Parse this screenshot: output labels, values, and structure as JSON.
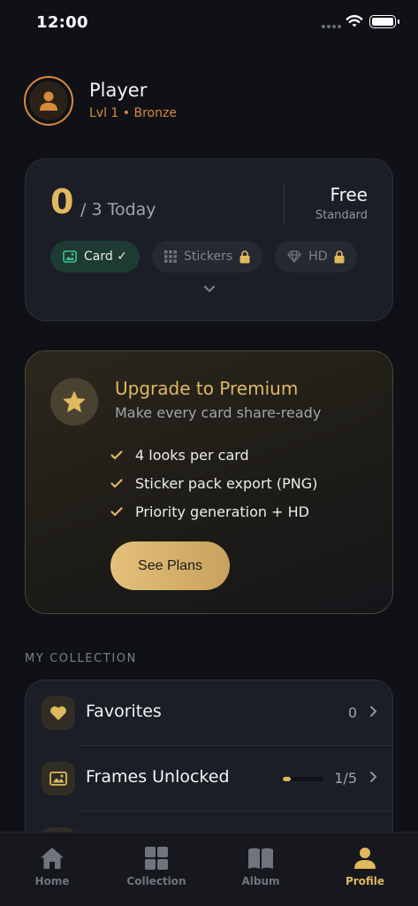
{
  "status": {
    "time": "12:00"
  },
  "profile": {
    "name": "Player",
    "level": "Lvl 1 • Bronze"
  },
  "usage": {
    "count": "0",
    "count_suffix": "/ 3 Today",
    "plan": "Free",
    "plan_tier": "Standard",
    "chips": [
      {
        "label": "Card ✓",
        "icon": "image-icon",
        "active": true
      },
      {
        "label": "Stickers",
        "icon": "grid-icon",
        "locked": true
      },
      {
        "label": "HD",
        "icon": "diamond-icon",
        "locked": true
      }
    ]
  },
  "premium": {
    "title": "Upgrade to Premium",
    "subtitle": "Make every card share-ready",
    "benefits": [
      "4 looks per card",
      "Sticker pack export (PNG)",
      "Priority generation + HD"
    ],
    "cta": "See Plans"
  },
  "collection": {
    "section_label": "MY COLLECTION",
    "rows": [
      {
        "label": "Favorites",
        "value": "0",
        "icon": "heart-icon"
      },
      {
        "label": "Frames Unlocked",
        "value": "1/5",
        "icon": "image-icon",
        "progress": 0.2
      }
    ]
  },
  "tabs": [
    {
      "label": "Home",
      "icon": "home-icon"
    },
    {
      "label": "Collection",
      "icon": "grid-icon"
    },
    {
      "label": "Album",
      "icon": "book-icon"
    },
    {
      "label": "Profile",
      "icon": "person-icon",
      "active": true
    }
  ],
  "colors": {
    "accent": "#e0b85e",
    "orange": "#d88a3a",
    "background": "#0f1116",
    "card": "#1b1e26"
  }
}
